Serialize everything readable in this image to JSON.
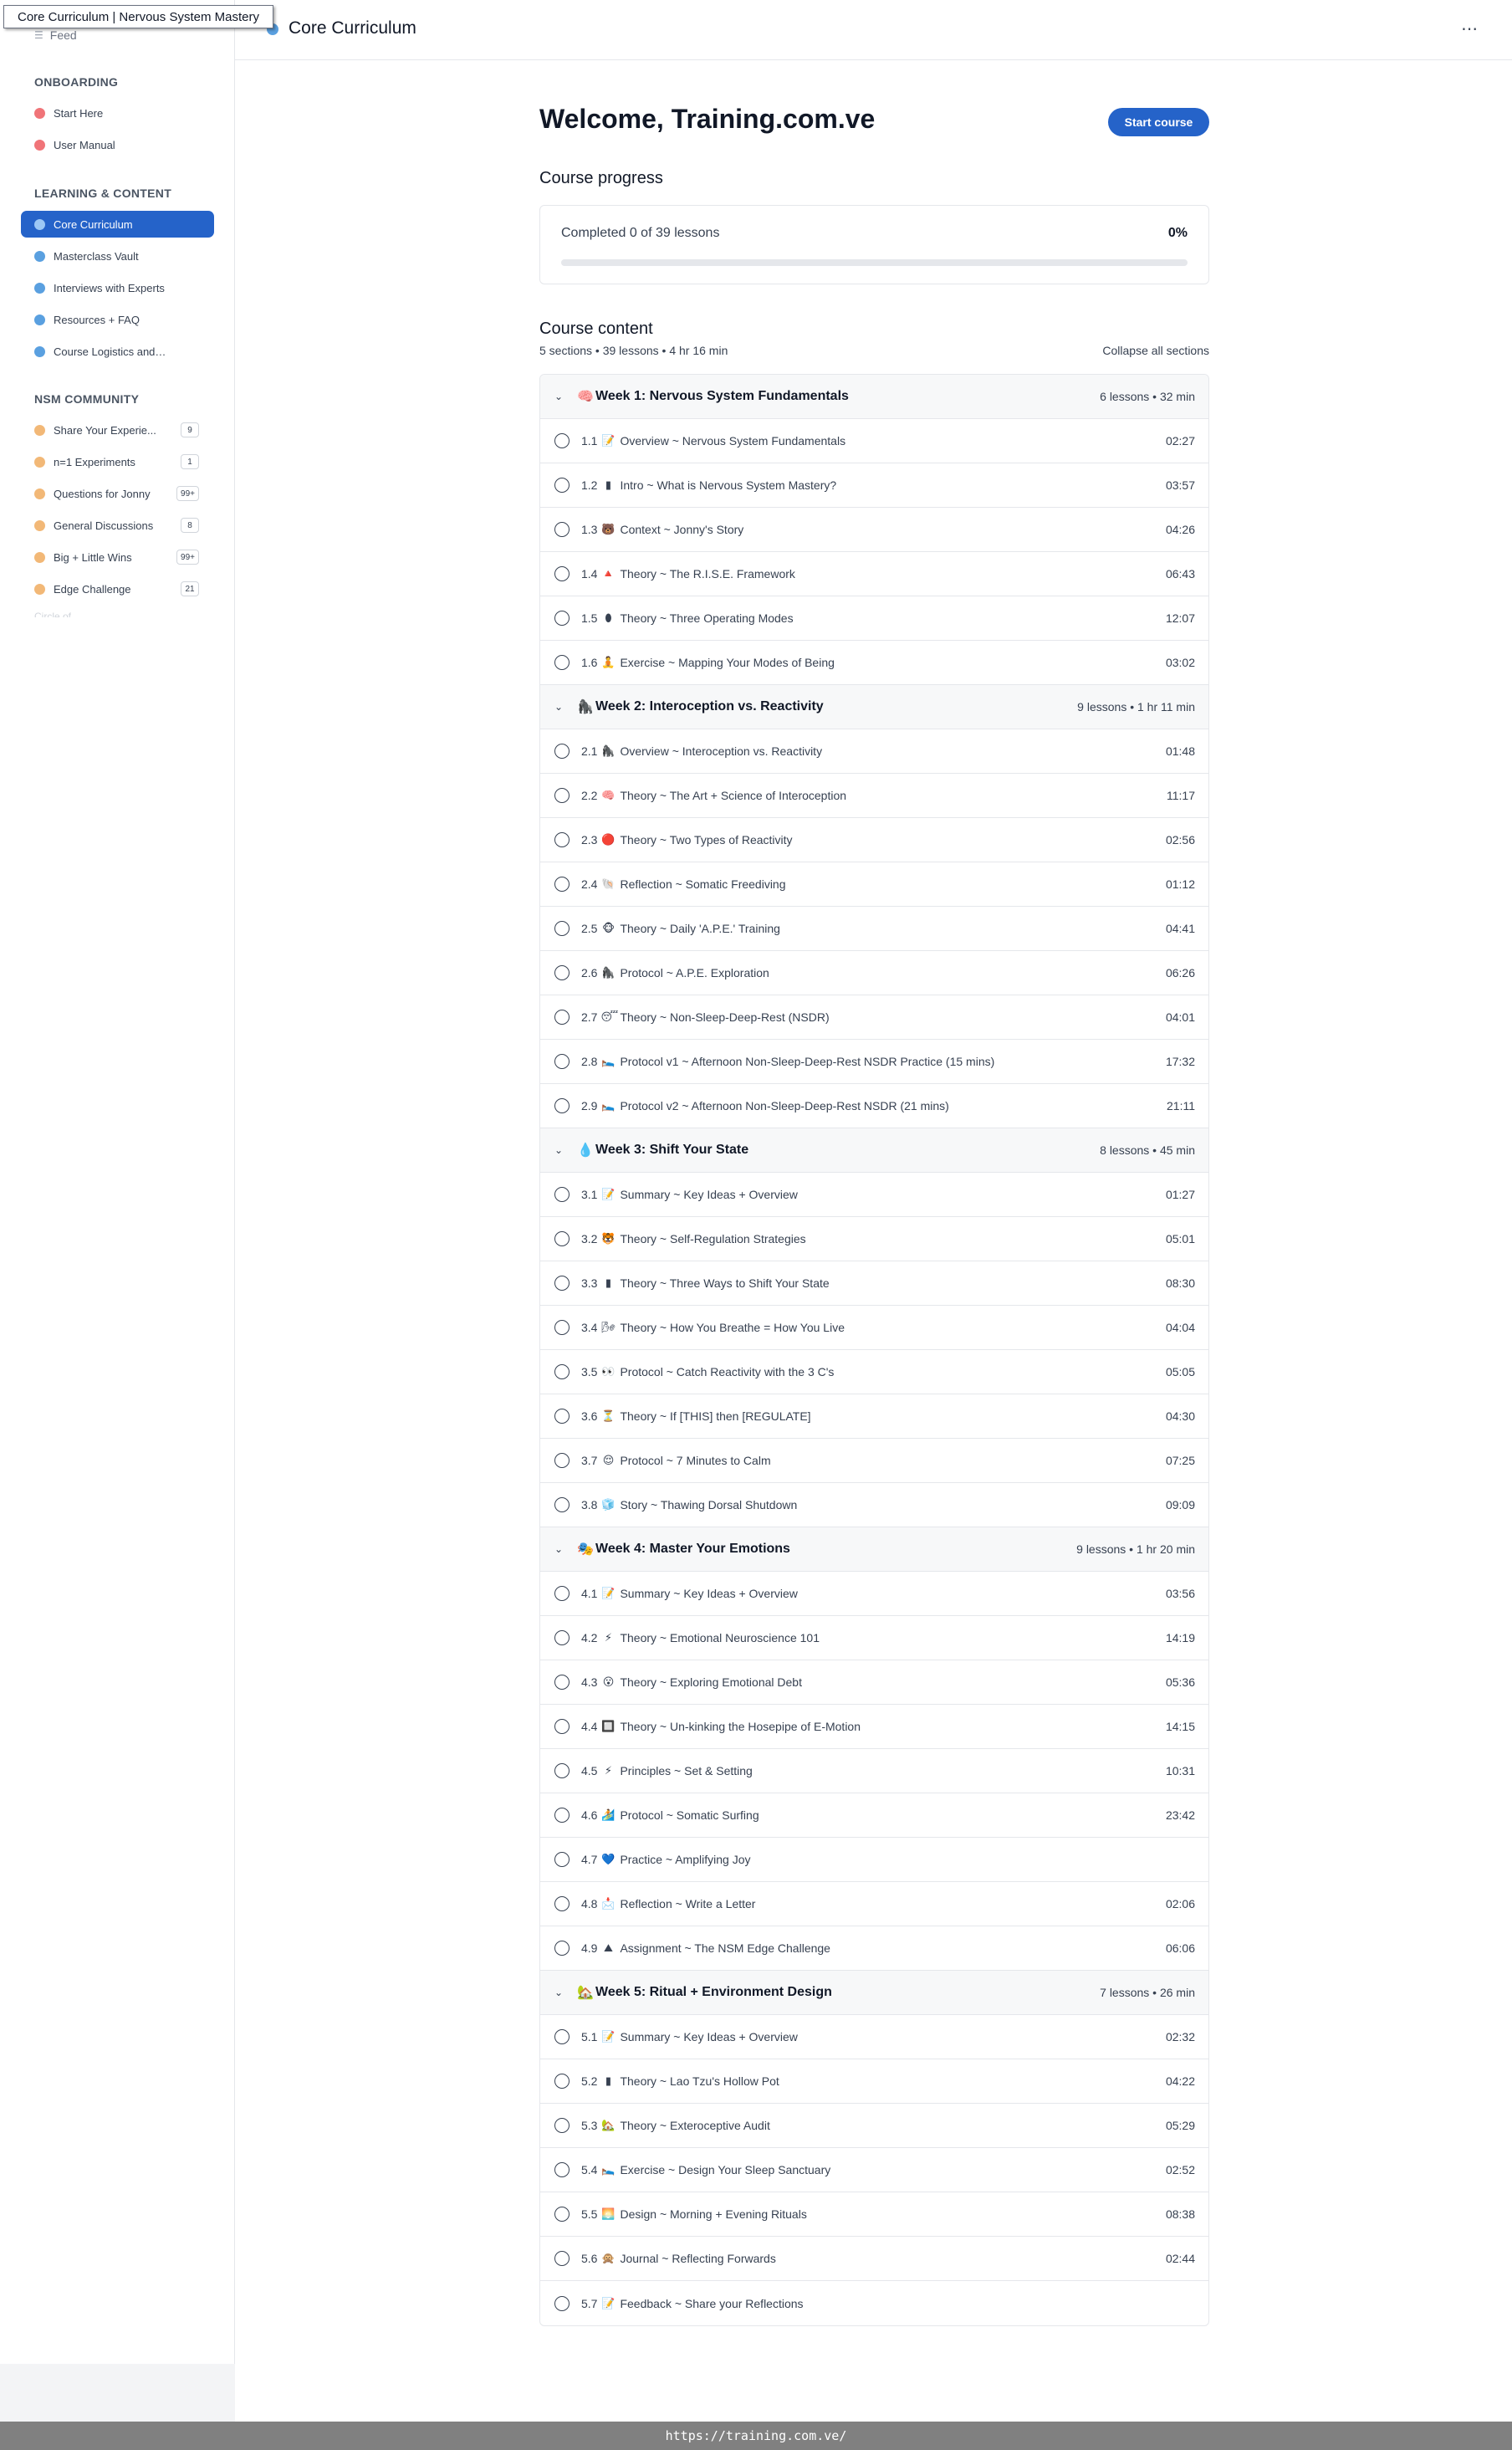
{
  "window": {
    "tooltip_title": "Core Curriculum | Nervous System Mastery"
  },
  "status_bar": {
    "url": "https://training.com.ve/"
  },
  "topbar": {
    "title": "Core Curriculum",
    "more_icon": "⋯"
  },
  "sidebar": {
    "feed_label": "Feed",
    "groups": [
      {
        "heading": "ONBOARDING",
        "items": [
          {
            "label": "Start Here",
            "dot": "red"
          },
          {
            "label": "User Manual",
            "dot": "red"
          }
        ]
      },
      {
        "heading": "LEARNING & CONTENT",
        "items": [
          {
            "label": "Core Curriculum",
            "dot": "blue",
            "active": true
          },
          {
            "label": "Masterclass Vault",
            "dot": "blue"
          },
          {
            "label": "Interviews with Experts",
            "dot": "blue"
          },
          {
            "label": "Resources + FAQ",
            "dot": "blue"
          },
          {
            "label": "Course Logistics and Fee...",
            "dot": "blue"
          }
        ]
      },
      {
        "heading": "NSM COMMUNITY",
        "items": [
          {
            "label": "Share Your Experie...",
            "dot": "orange",
            "badge": "9"
          },
          {
            "label": "n=1 Experiments",
            "dot": "orange",
            "badge": "1"
          },
          {
            "label": "Questions for Jonny",
            "dot": "orange",
            "badge": "99+"
          },
          {
            "label": "General Discussions",
            "dot": "orange",
            "badge": "8"
          },
          {
            "label": "Big + Little Wins",
            "dot": "orange",
            "badge": "99+"
          },
          {
            "label": "Edge Challenge",
            "dot": "orange",
            "badge": "21"
          }
        ]
      }
    ]
  },
  "main": {
    "welcome": "Welcome, Training.com.ve",
    "start_button": "Start course",
    "progress_heading": "Course progress",
    "progress_text": "Completed 0 of 39 lessons",
    "progress_pct": "0%",
    "progress_value": 0,
    "content_heading": "Course content",
    "content_meta": "5 sections • 39 lessons • 4 hr 16 min",
    "collapse_label": "Collapse all sections"
  },
  "sections": [
    {
      "emoji": "🧠",
      "title": "Week 1: Nervous System Fundamentals",
      "meta": "6 lessons • 32 min",
      "lessons": [
        {
          "num": "1.1",
          "emoji": "📝",
          "title": "Overview ~ Nervous System Fundamentals",
          "dur": "02:27"
        },
        {
          "num": "1.2",
          "emoji": "▮",
          "title": "Intro ~ What is Nervous System Mastery?",
          "dur": "03:57"
        },
        {
          "num": "1.3",
          "emoji": "🐻",
          "title": "Context ~ Jonny's Story",
          "dur": "04:26"
        },
        {
          "num": "1.4",
          "emoji": "🔺",
          "title": "Theory ~ The R.I.S.E. Framework",
          "dur": "06:43"
        },
        {
          "num": "1.5",
          "emoji": "⬮",
          "title": "Theory ~ Three Operating Modes",
          "dur": "12:07"
        },
        {
          "num": "1.6",
          "emoji": "🧘",
          "title": "Exercise ~ Mapping Your Modes of Being",
          "dur": "03:02"
        }
      ]
    },
    {
      "emoji": "🦍",
      "title": "Week 2: Interoception vs. Reactivity",
      "meta": "9 lessons • 1 hr 11 min",
      "lessons": [
        {
          "num": "2.1",
          "emoji": "🦍",
          "title": "Overview ~ Interoception vs. Reactivity",
          "dur": "01:48"
        },
        {
          "num": "2.2",
          "emoji": "🧠",
          "title": "Theory ~ The Art + Science of Interoception",
          "dur": "11:17"
        },
        {
          "num": "2.3",
          "emoji": "🔴",
          "title": "Theory ~ Two Types of Reactivity",
          "dur": "02:56"
        },
        {
          "num": "2.4",
          "emoji": "🐚",
          "title": "Reflection ~ Somatic Freediving",
          "dur": "01:12"
        },
        {
          "num": "2.5",
          "emoji": "🐵",
          "title": "Theory ~ Daily 'A.P.E.' Training",
          "dur": "04:41"
        },
        {
          "num": "2.6",
          "emoji": "🦍",
          "title": "Protocol ~ A.P.E. Exploration",
          "dur": "06:26"
        },
        {
          "num": "2.7",
          "emoji": "😴",
          "title": "Theory ~ Non-Sleep-Deep-Rest (NSDR)",
          "dur": "04:01"
        },
        {
          "num": "2.8",
          "emoji": "🛌",
          "title": "Protocol v1 ~ Afternoon Non-Sleep-Deep-Rest NSDR Practice (15 mins)",
          "dur": "17:32"
        },
        {
          "num": "2.9",
          "emoji": "🛌",
          "title": "Protocol v2 ~ Afternoon Non-Sleep-Deep-Rest NSDR (21 mins)",
          "dur": "21:11"
        }
      ]
    },
    {
      "emoji": "💧",
      "title": "Week 3: Shift Your State",
      "meta": "8 lessons • 45 min",
      "lessons": [
        {
          "num": "3.1",
          "emoji": "📝",
          "title": "Summary ~ Key Ideas + Overview",
          "dur": "01:27"
        },
        {
          "num": "3.2",
          "emoji": "🐯",
          "title": "Theory ~ Self-Regulation Strategies",
          "dur": "05:01"
        },
        {
          "num": "3.3",
          "emoji": "▮",
          "title": "Theory ~ Three Ways to Shift Your State",
          "dur": "08:30"
        },
        {
          "num": "3.4",
          "emoji": "🌬",
          "title": "Theory ~ How You Breathe = How You Live",
          "dur": "04:04"
        },
        {
          "num": "3.5",
          "emoji": "👀",
          "title": "Protocol ~ Catch Reactivity with the 3 C's",
          "dur": "05:05"
        },
        {
          "num": "3.6",
          "emoji": "⏳",
          "title": "Theory ~ If [THIS] then [REGULATE]",
          "dur": "04:30"
        },
        {
          "num": "3.7",
          "emoji": "😌",
          "title": "Protocol ~ 7 Minutes to Calm",
          "dur": "07:25"
        },
        {
          "num": "3.8",
          "emoji": "🧊",
          "title": "Story ~ Thawing Dorsal Shutdown",
          "dur": "09:09"
        }
      ]
    },
    {
      "emoji": "🎭",
      "title": "Week 4: Master Your Emotions",
      "meta": "9 lessons • 1 hr 20 min",
      "lessons": [
        {
          "num": "4.1",
          "emoji": "📝",
          "title": "Summary ~ Key Ideas + Overview",
          "dur": "03:56"
        },
        {
          "num": "4.2",
          "emoji": "⚡",
          "title": "Theory ~ Emotional Neuroscience 101",
          "dur": "14:19"
        },
        {
          "num": "4.3",
          "emoji": "😮",
          "title": "Theory ~ Exploring Emotional Debt",
          "dur": "05:36"
        },
        {
          "num": "4.4",
          "emoji": "🔲",
          "title": "Theory ~ Un-kinking the Hosepipe of E-Motion",
          "dur": "14:15"
        },
        {
          "num": "4.5",
          "emoji": "⚡",
          "title": "Principles ~ Set & Setting",
          "dur": "10:31"
        },
        {
          "num": "4.6",
          "emoji": "🏄",
          "title": "Protocol ~ Somatic Surfing",
          "dur": "23:42"
        },
        {
          "num": "4.7",
          "emoji": "💙",
          "title": "Practice ~ Amplifying Joy",
          "dur": ""
        },
        {
          "num": "4.8",
          "emoji": "📩",
          "title": "Reflection ~ Write a Letter",
          "dur": "02:06"
        },
        {
          "num": "4.9",
          "emoji": "⛰",
          "title": "Assignment ~ The NSM Edge Challenge",
          "dur": "06:06"
        }
      ]
    },
    {
      "emoji": "🏡",
      "title": "Week 5: Ritual + Environment Design",
      "meta": "7 lessons • 26 min",
      "lessons": [
        {
          "num": "5.1",
          "emoji": "📝",
          "title": "Summary ~ Key Ideas + Overview",
          "dur": "02:32"
        },
        {
          "num": "5.2",
          "emoji": "▮",
          "title": "Theory ~ Lao Tzu's Hollow Pot",
          "dur": "04:22"
        },
        {
          "num": "5.3",
          "emoji": "🏡",
          "title": "Theory ~ Exteroceptive Audit",
          "dur": "05:29"
        },
        {
          "num": "5.4",
          "emoji": "🛌",
          "title": "Exercise ~ Design Your Sleep Sanctuary",
          "dur": "02:52"
        },
        {
          "num": "5.5",
          "emoji": "🌅",
          "title": "Design ~ Morning + Evening Rituals",
          "dur": "08:38"
        },
        {
          "num": "5.6",
          "emoji": "🙊",
          "title": "Journal ~ Reflecting Forwards",
          "dur": "02:44"
        },
        {
          "num": "5.7",
          "emoji": "📝",
          "title": "Feedback ~ Share your Reflections",
          "dur": ""
        }
      ]
    }
  ]
}
